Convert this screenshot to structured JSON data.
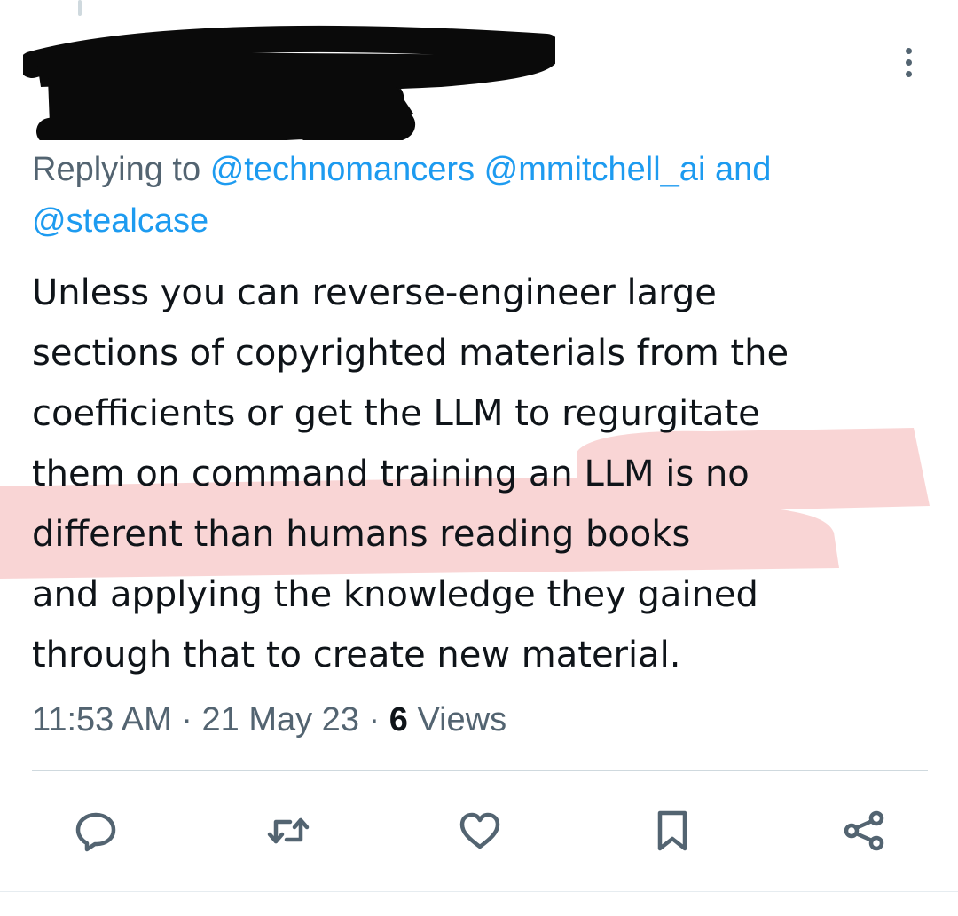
{
  "reply_context": {
    "prefix": "Replying to",
    "mentions": [
      "@technomancers",
      "@mmitchell_ai",
      "@stealcase"
    ],
    "connector": "and"
  },
  "tweet": {
    "lines": [
      "Unless you can reverse-engineer large",
      "sections of copyrighted materials from the",
      "coefficients or get the LLM to regurgitate",
      "them on command training an LLM is no",
      "different than humans reading books",
      "and applying the knowledge they gained",
      "through that to create new material."
    ]
  },
  "meta": {
    "time": "11:53 AM",
    "separator": "·",
    "date": "21 May 23",
    "views_count": "6",
    "views_label": "Views"
  },
  "actions": {
    "icons": [
      "reply-icon",
      "retweet-icon",
      "like-icon",
      "bookmark-icon",
      "share-icon"
    ]
  },
  "colors": {
    "mention": "#1d9bf0",
    "secondary_text": "#536471",
    "highlight": "#f7c5c5",
    "redaction": "#0a0a0a"
  }
}
